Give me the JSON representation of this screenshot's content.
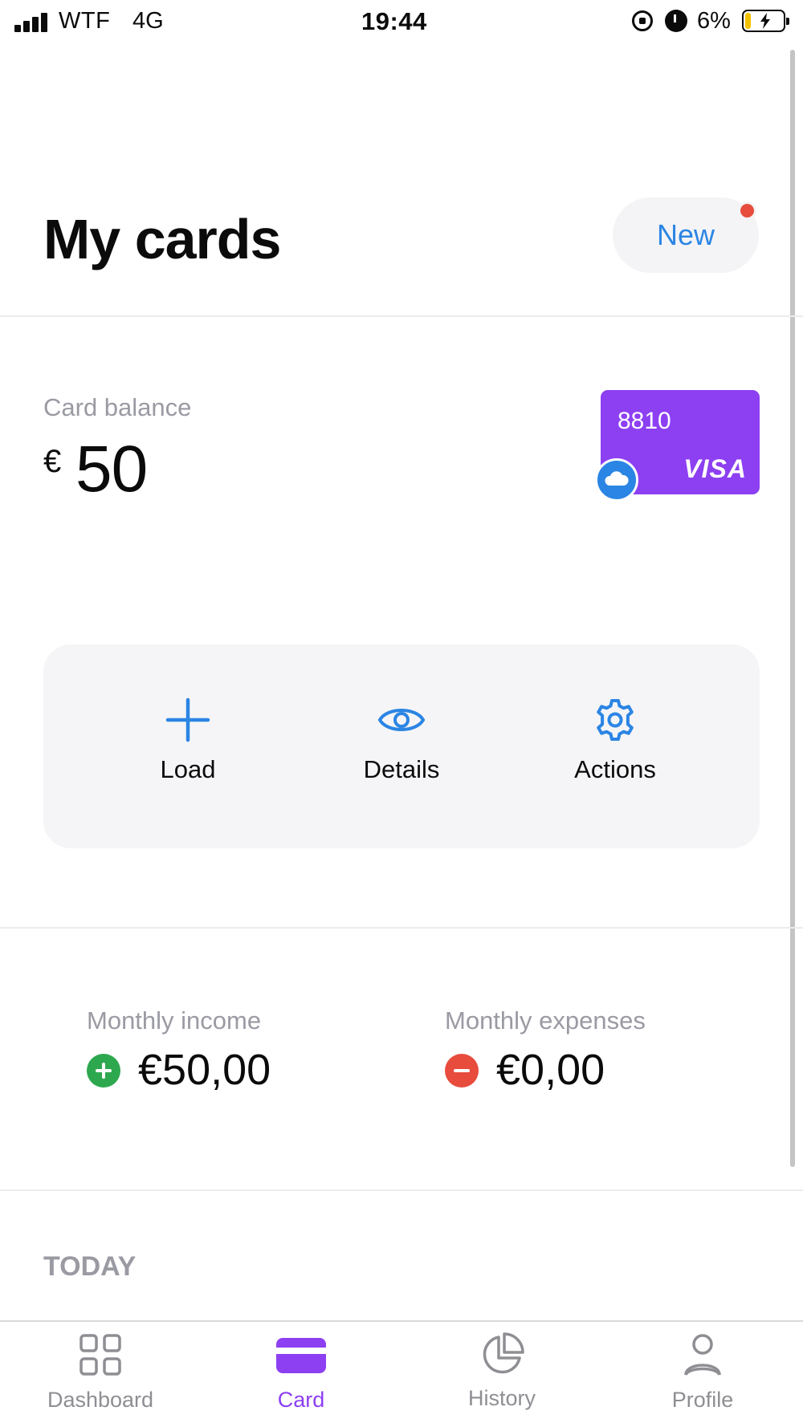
{
  "status_bar": {
    "carrier": "WTF",
    "network": "4G",
    "time": "19:44",
    "battery_percent": "6%",
    "icons": [
      "signal-icon",
      "orientation-lock-icon",
      "alarm-icon",
      "battery-charging-icon"
    ]
  },
  "header": {
    "title": "My cards",
    "new_button_label": "New",
    "new_badge_color": "#e74c3c"
  },
  "balance": {
    "label": "Card balance",
    "currency": "€",
    "amount": "50"
  },
  "card": {
    "last4": "8810",
    "brand": "VISA",
    "color": "#8d3ff2",
    "badge_icon": "cloud-icon"
  },
  "actions": [
    {
      "label": "Load",
      "icon": "plus-icon"
    },
    {
      "label": "Details",
      "icon": "eye-icon"
    },
    {
      "label": "Actions",
      "icon": "gear-icon"
    }
  ],
  "monthly": {
    "income_label": "Monthly income",
    "income_value": "€50,00",
    "income_color": "#2ea84f",
    "expenses_label": "Monthly expenses",
    "expenses_value": "€0,00",
    "expenses_color": "#e74c3c"
  },
  "transactions": {
    "section_heading": "TODAY"
  },
  "tab_bar": {
    "tabs": [
      {
        "label": "Dashboard",
        "icon": "grid-icon",
        "active": false
      },
      {
        "label": "Card",
        "icon": "card-icon",
        "active": true
      },
      {
        "label": "History",
        "icon": "pie-chart-icon",
        "active": false
      },
      {
        "label": "Profile",
        "icon": "person-icon",
        "active": false
      }
    ]
  },
  "colors": {
    "accent_blue": "#2b85e4",
    "accent_purple": "#8d3ff2",
    "muted_text": "#9a9aa3"
  }
}
